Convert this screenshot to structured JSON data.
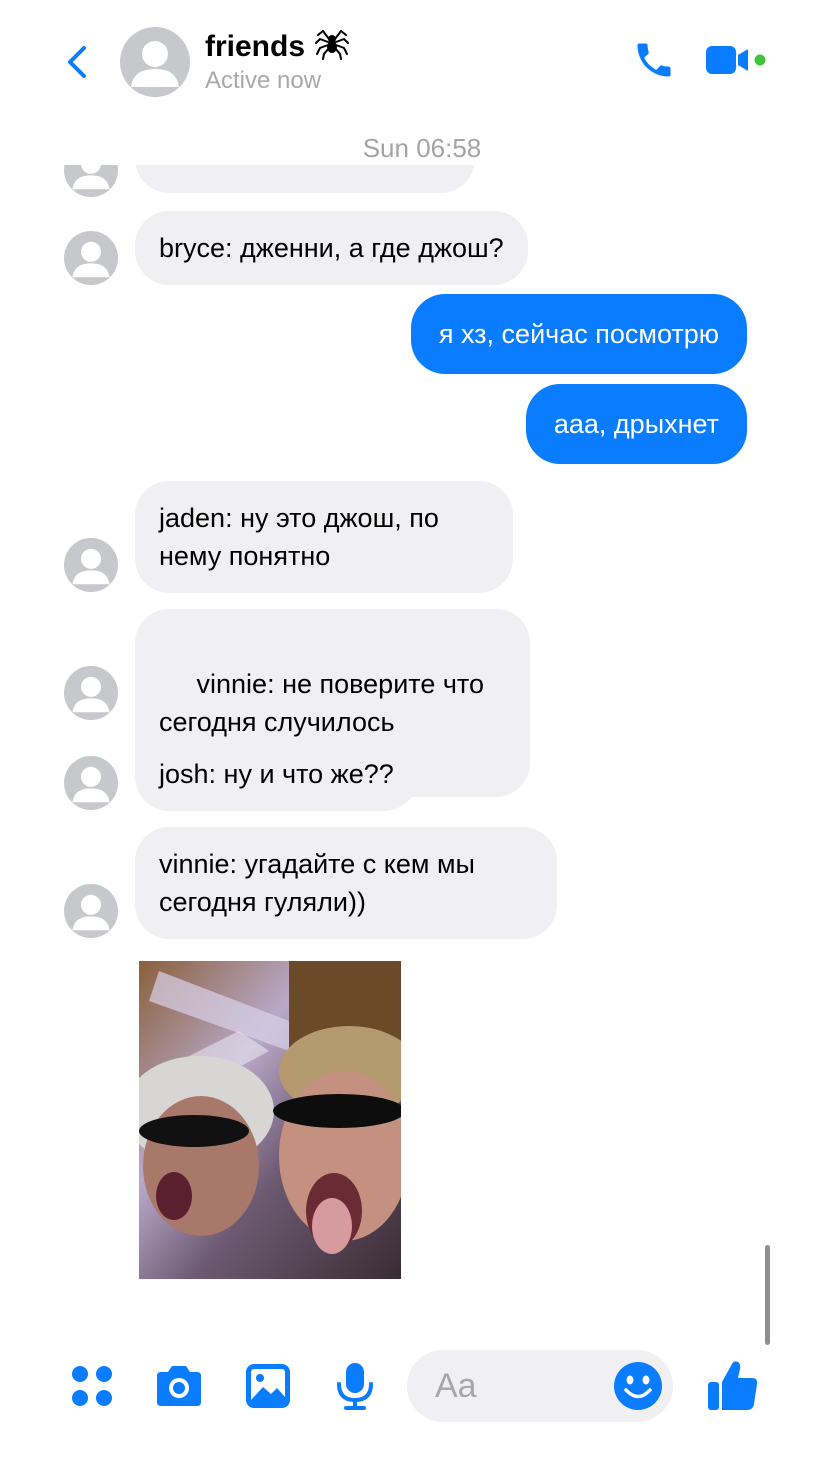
{
  "header": {
    "title": "friends",
    "status": "Active now",
    "back_icon": "chevron-left-icon",
    "call_icon": "phone-icon",
    "video_icon": "video-camera-icon",
    "accent_color": "#0a7cff",
    "active_color": "#3ec33a"
  },
  "timestamp": "Sun 06:58",
  "messages": [
    {
      "side": "in",
      "text": "bryce: дженни, а где джош?"
    },
    {
      "side": "out",
      "text": "я хз, сейчас посмотрю"
    },
    {
      "side": "out",
      "text": "ааа, дрыхнет"
    },
    {
      "side": "in",
      "text": "jaden: ну это джош, по нему понятно"
    },
    {
      "side": "in",
      "text": " vinnie: не поверите что сегодня случилось"
    },
    {
      "side": "in",
      "text": "josh: ну и что же??"
    },
    {
      "side": "in",
      "text": "vinnie: угадайте с кем мы сегодня гуляли))"
    }
  ],
  "composer": {
    "placeholder": "Aa",
    "icons": [
      "apps-icon",
      "camera-icon",
      "gallery-icon",
      "microphone-icon",
      "emoji-icon",
      "thumbs-up-icon"
    ]
  }
}
